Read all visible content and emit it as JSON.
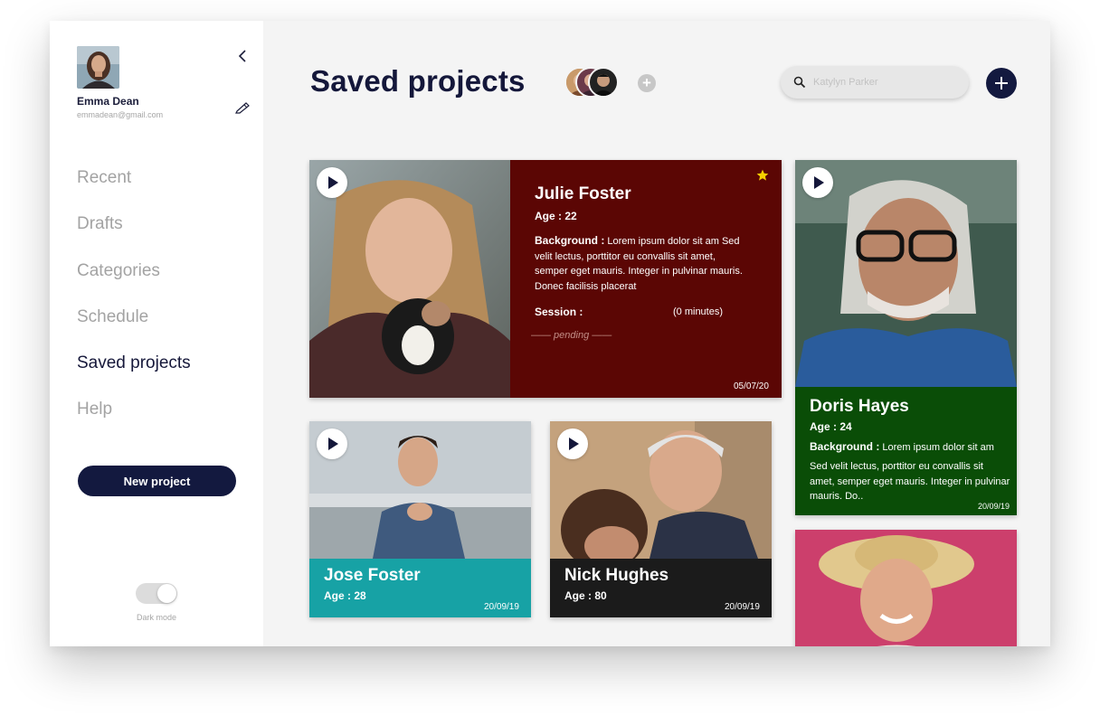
{
  "user": {
    "name": "Emma Dean",
    "email": "emmadean@gmail.com"
  },
  "nav": {
    "items": [
      {
        "label": "Recent"
      },
      {
        "label": "Drafts"
      },
      {
        "label": "Categories"
      },
      {
        "label": "Schedule"
      },
      {
        "label": "Saved projects",
        "active": true
      },
      {
        "label": "Help"
      }
    ]
  },
  "sidebar": {
    "new_project_label": "New project",
    "dark_mode_label": "Dark mode",
    "dark_mode_on": false
  },
  "header": {
    "title": "Saved projects",
    "add_collaborator": "+",
    "search_placeholder": "Katylyn Parker"
  },
  "colors": {
    "navy": "#13193f",
    "julie_panel": "#5b0604",
    "doris_panel": "#0a4d07",
    "jose_panel": "#17a2a5",
    "nick_panel": "#1b1b1b",
    "star": "#f5d100"
  },
  "cards": {
    "julie": {
      "name": "Julie Foster",
      "age": "Age : 22",
      "background_label": "Background :",
      "background_text": "Lorem ipsum dolor sit am Sed velit lectus, porttitor eu convallis sit amet, semper eget mauris. Integer in pulvinar mauris. Donec facilisis placerat",
      "session_label": "Session :",
      "session_value": "(0 minutes)",
      "status": "—— pending ——",
      "date": "05/07/20",
      "starred": true
    },
    "doris": {
      "name": "Doris Hayes",
      "age": "Age : 24",
      "background_label": "Background :",
      "background_text": "Lorem ipsum dolor sit am",
      "background_text_2": "Sed velit lectus, porttitor eu convallis sit amet, semper eget mauris. Integer in pulvinar mauris. Do..",
      "date": "20/09/19"
    },
    "jose": {
      "name": "Jose Foster",
      "age": "Age : 28",
      "date": "20/09/19"
    },
    "nick": {
      "name": "Nick Hughes",
      "age": "Age : 80",
      "date": "20/09/19"
    }
  }
}
